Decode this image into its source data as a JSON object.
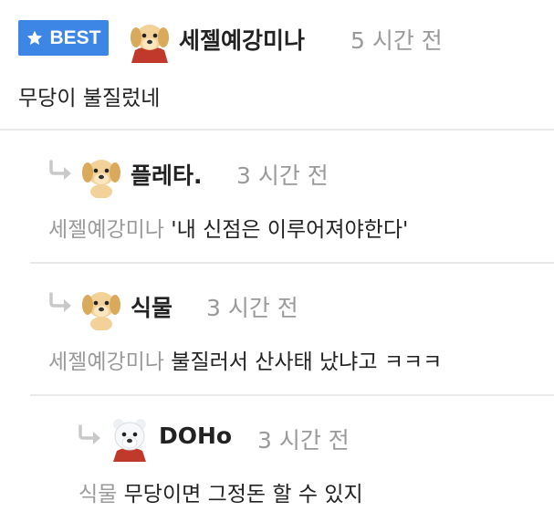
{
  "best_comment": {
    "badge": "BEST",
    "author": "세젤예강미나",
    "time": "5 시간 전",
    "content": "무당이 불질렀네"
  },
  "replies": [
    {
      "author": "플레타.",
      "time": "3 시간 전",
      "mention": "세젤예강미나",
      "content": "'내 신점은 이루어져야한다'"
    },
    {
      "author": "식물",
      "time": "3 시간 전",
      "mention": "세젤예강미나",
      "content": "불질러서 산사태 났냐고 ㅋㅋㅋ"
    },
    {
      "author": "DOHo",
      "time": "3 시간 전",
      "mention": "식물",
      "content": "무당이면 그정돈 할 수 있지"
    }
  ],
  "colors": {
    "badge_blue": "#3d86e6",
    "muted_text": "#9a9a9a",
    "divider": "#e9e9e9"
  }
}
